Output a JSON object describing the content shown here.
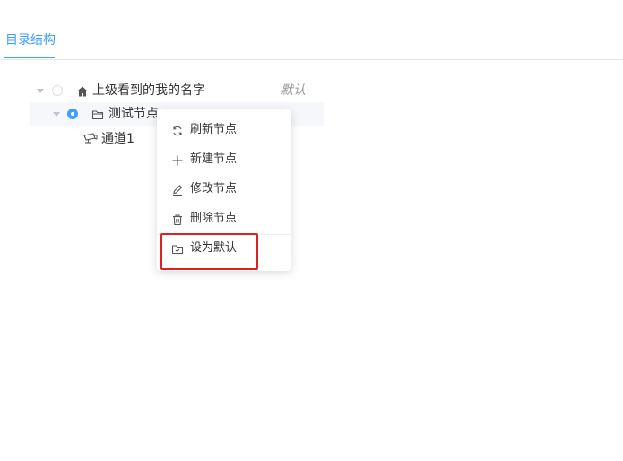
{
  "tabs": {
    "active_label": "目录结构"
  },
  "tree": {
    "root": {
      "label": "上级看到的我的名字",
      "icon": "home-icon",
      "default_tag": "默认"
    },
    "child": {
      "label": "测试节点",
      "icon": "folder-icon",
      "selected": true
    },
    "leaf": {
      "label": "通道1",
      "icon": "camera-icon"
    }
  },
  "context_menu": {
    "items": [
      {
        "label": "刷新节点",
        "icon": "refresh-icon"
      },
      {
        "label": "新建节点",
        "icon": "plus-icon"
      },
      {
        "label": "修改节点",
        "icon": "edit-icon"
      },
      {
        "label": "删除节点",
        "icon": "delete-icon"
      },
      {
        "label": "设为默认",
        "icon": "folder-check-icon"
      }
    ]
  },
  "colors": {
    "accent": "#409eff",
    "highlight": "#e02020",
    "muted": "#999999"
  }
}
